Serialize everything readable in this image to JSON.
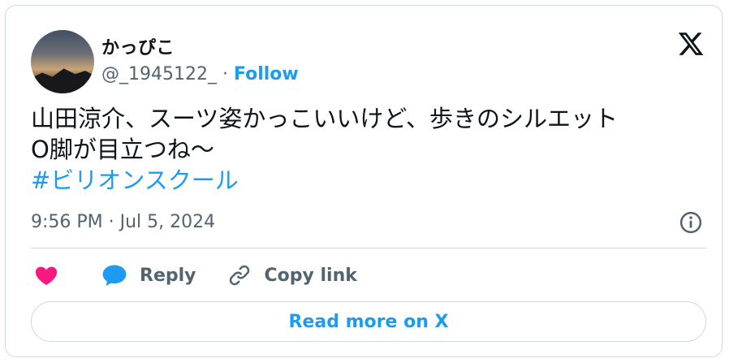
{
  "user": {
    "display_name": "かっぴこ",
    "handle": "@_1945122_",
    "separator": " · ",
    "follow_label": "Follow"
  },
  "tweet": {
    "line1": "山田涼介、スーツ姿かっこいいけど、歩きのシルエット",
    "line2": "O脚が目立つね〜",
    "hashtag": "#ビリオンスクール",
    "timestamp": "9:56 PM · Jul 5, 2024"
  },
  "actions": {
    "reply_label": "Reply",
    "copy_link_label": "Copy link",
    "read_more_label": "Read more on X"
  },
  "icons": {
    "logo": "x-logo-icon",
    "info": "info-icon",
    "like": "heart-icon",
    "reply": "reply-bubble-icon",
    "copy": "link-icon"
  },
  "colors": {
    "accent": "#1d9bf0",
    "heart": "#f91880",
    "text": "#0f1419",
    "secondary": "#536471",
    "border": "#cfd9de"
  }
}
